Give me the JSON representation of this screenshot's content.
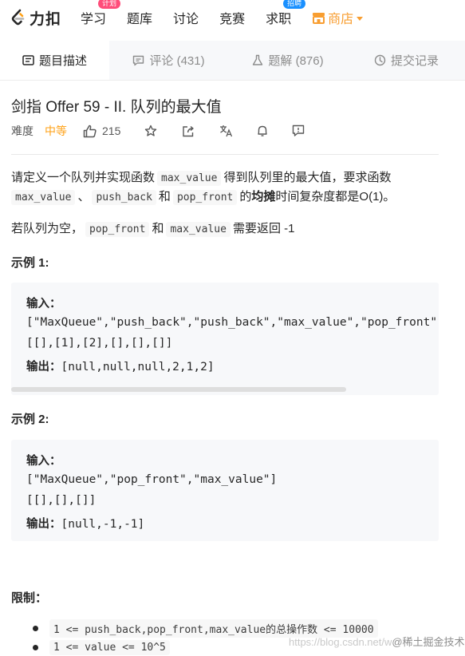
{
  "nav": {
    "logo_text": "力扣",
    "items": [
      {
        "label": "学习",
        "badge": "计划"
      },
      {
        "label": "题库"
      },
      {
        "label": "讨论"
      },
      {
        "label": "竞赛"
      },
      {
        "label": "求职",
        "badge": "招聘"
      }
    ],
    "shop_label": "商店"
  },
  "tabs": [
    {
      "label": "题目描述",
      "icon": "description-icon",
      "active": true
    },
    {
      "label": "评论 (431)",
      "icon": "comment-icon"
    },
    {
      "label": "题解 (876)",
      "icon": "flask-icon"
    },
    {
      "label": "提交记录",
      "icon": "history-icon"
    }
  ],
  "problem": {
    "title": "剑指 Offer 59 - II. 队列的最大值",
    "difficulty_label": "难度",
    "difficulty": "中等",
    "likes": "215"
  },
  "description": {
    "p1_a": "请定义一个队列并实现函数",
    "p1_code1": "max_value",
    "p1_b": "得到队列里的最大值，要求函数",
    "p2_code1": "max_value",
    "p2_a": "、",
    "p2_code2": "push_back",
    "p2_b": "和",
    "p2_code3": "pop_front",
    "p2_c": "的",
    "p2_bold": "均摊",
    "p2_d": "时间复杂度都是O(1)。",
    "p3_a": "若队列为空，",
    "p3_code1": "pop_front",
    "p3_b": "和",
    "p3_code2": "max_value",
    "p3_c": "需要返回 -1"
  },
  "examples": [
    {
      "heading": "示例 1:",
      "input_label": "输入：",
      "input_line1": "[\"MaxQueue\",\"push_back\",\"push_back\",\"max_value\",\"pop_front\",\"max_value\"]",
      "input_line2": "[[],[1],[2],[],[],[]]",
      "output_label": "输出：",
      "output": "[null,null,null,2,1,2]"
    },
    {
      "heading": "示例 2:",
      "input_label": "输入：",
      "input_line1": "[\"MaxQueue\",\"pop_front\",\"max_value\"]",
      "input_line2": "[[],[],[]]",
      "output_label": "输出：",
      "output": "[null,-1,-1]"
    }
  ],
  "constraints": {
    "heading": "限制：",
    "item1_code": "1 <= push_back,pop_front,max_value的总操作数 <= 10000",
    "item2_code": "1 <= value <= 10^5"
  },
  "watermark": {
    "part1": "https://blog.csdn.net/w",
    "part2": "@稀土掘金技术社区"
  },
  "colors": {
    "difficulty": "#ffa116",
    "shop": "#f89e31",
    "badge_pink": "#ff4d7a",
    "badge_blue": "#1a90ff"
  }
}
